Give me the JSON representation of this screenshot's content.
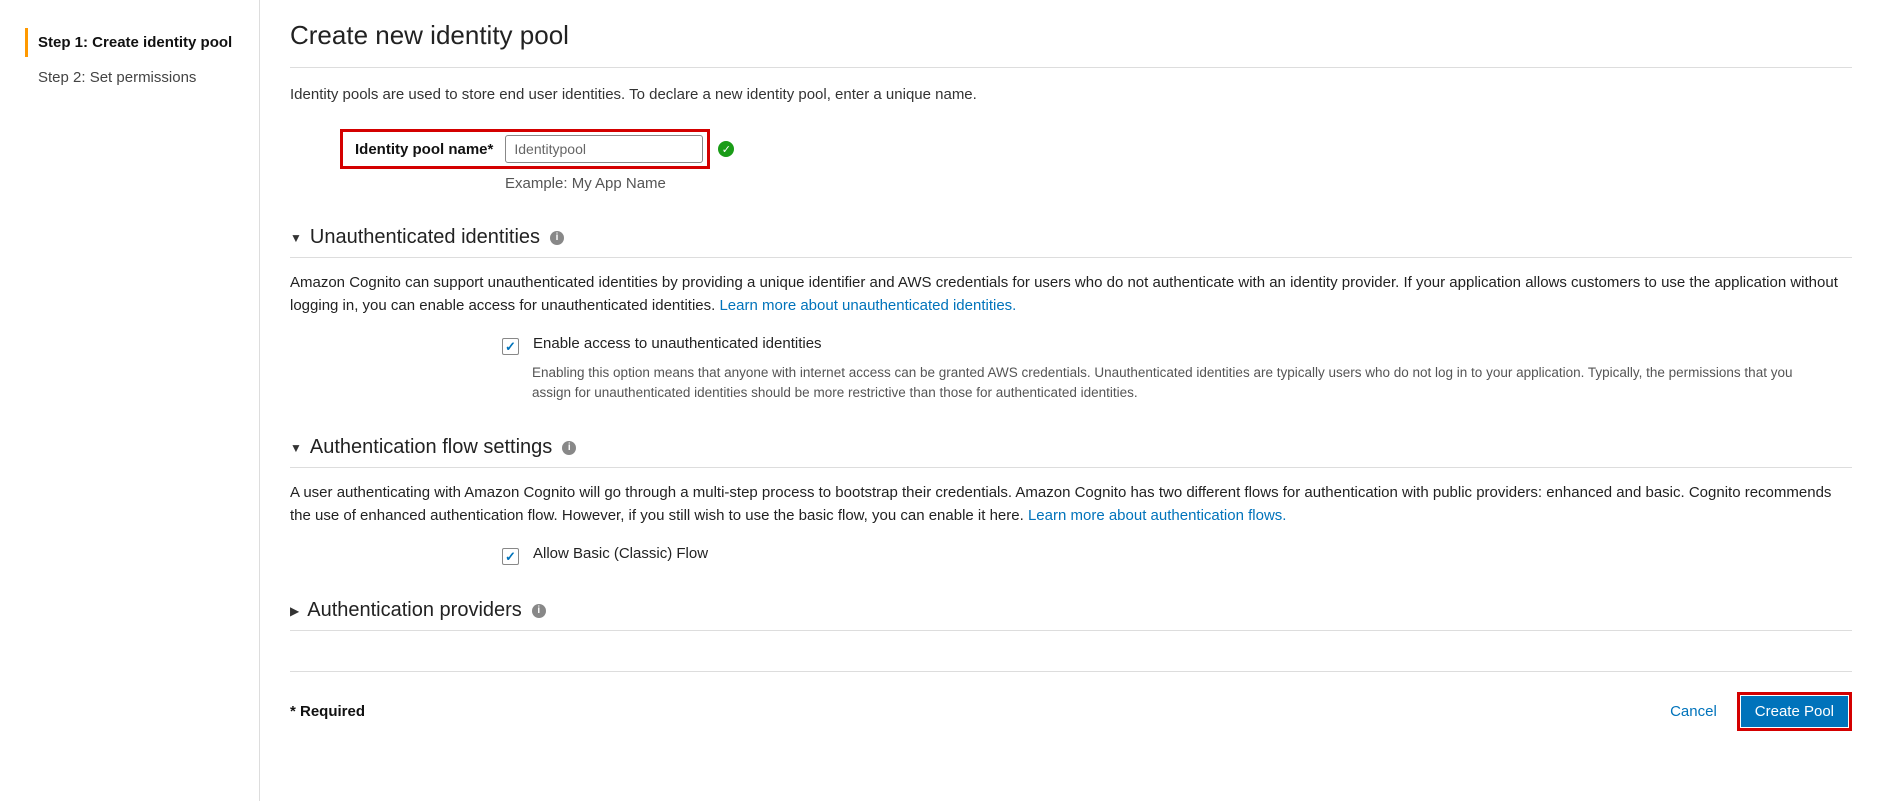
{
  "sidebar": {
    "steps": [
      {
        "label": "Step 1: Create identity pool",
        "active": true
      },
      {
        "label": "Step 2: Set permissions",
        "active": false
      }
    ]
  },
  "page": {
    "title": "Create new identity pool",
    "intro": "Identity pools are used to store end user identities. To declare a new identity pool, enter a unique name."
  },
  "name_field": {
    "label": "Identity pool name*",
    "value": "Identitypool",
    "example": "Example: My App Name"
  },
  "sections": {
    "unauth": {
      "title": "Unauthenticated identities",
      "body_pre": "Amazon Cognito can support unauthenticated identities by providing a unique identifier and AWS credentials for users who do not authenticate with an identity provider. If your application allows customers to use the application without logging in, you can enable access for unauthenticated identities. ",
      "link": "Learn more about unauthenticated identities.",
      "checkbox_label": "Enable access to unauthenticated identities",
      "checkbox_desc": "Enabling this option means that anyone with internet access can be granted AWS credentials. Unauthenticated identities are typically users who do not log in to your application. Typically, the permissions that you assign for unauthenticated identities should be more restrictive than those for authenticated identities."
    },
    "flow": {
      "title": "Authentication flow settings",
      "body_pre": "A user authenticating with Amazon Cognito will go through a multi-step process to bootstrap their credentials. Amazon Cognito has two different flows for authentication with public providers: enhanced and basic. Cognito recommends the use of enhanced authentication flow. However, if you still wish to use the basic flow, you can enable it here. ",
      "link": "Learn more about authentication flows.",
      "checkbox_label": "Allow Basic (Classic) Flow"
    },
    "providers": {
      "title": "Authentication providers"
    }
  },
  "footer": {
    "required": "* Required",
    "cancel": "Cancel",
    "create": "Create Pool"
  }
}
